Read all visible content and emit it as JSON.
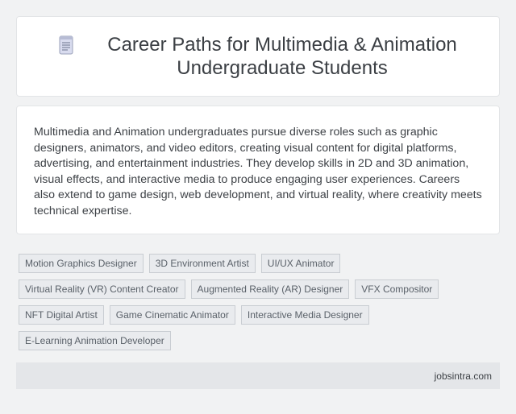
{
  "header": {
    "title": "Career Paths for Multimedia & Animation Undergraduate Students",
    "icon": "document-icon"
  },
  "description": {
    "text": "Multimedia and Animation undergraduates pursue diverse roles such as graphic designers, animators, and video editors, creating visual content for digital platforms, advertising, and entertainment industries. They develop skills in 2D and 3D animation, visual effects, and interactive media to produce engaging user experiences. Careers also extend to game design, web development, and virtual reality, where creativity meets technical expertise."
  },
  "tags": [
    "Motion Graphics Designer",
    "3D Environment Artist",
    "UI/UX Animator",
    "Virtual Reality (VR) Content Creator",
    "Augmented Reality (AR) Designer",
    "VFX Compositor",
    "NFT Digital Artist",
    "Game Cinematic Animator",
    "Interactive Media Designer",
    "E-Learning Animation Developer"
  ],
  "footer": {
    "site": "jobsintra.com"
  },
  "colors": {
    "page_bg": "#f1f2f3",
    "card_bg": "#ffffff",
    "tag_bg": "#e9ebee",
    "tag_border": "#c9cdd2",
    "footer_bg": "#e4e6e9"
  }
}
